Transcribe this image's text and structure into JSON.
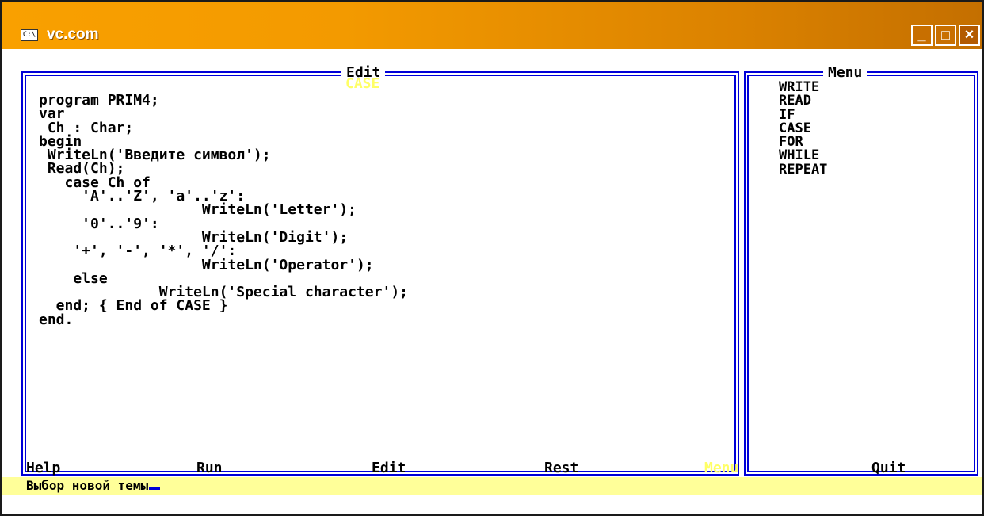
{
  "window": {
    "title": "vc.com",
    "icon": "console-icon",
    "icon_label": "C:\\",
    "buttons": {
      "minimize": "_",
      "maximize": "□",
      "close": "×"
    }
  },
  "edit_panel": {
    "title": "Edit",
    "subtitle": "CASE",
    "code_lines": [
      "program PRIM4;",
      "var",
      " Ch : Char;",
      "begin",
      " WriteLn('Введите символ');",
      " Read(Ch);",
      "   case Ch of",
      "     'A'..'Z', 'a'..'z':",
      "                   WriteLn('Letter');",
      "     '0'..'9':",
      "                   WriteLn('Digit');",
      "    '+', '-', '*', '/':",
      "                   WriteLn('Operator');",
      "    else",
      "              WriteLn('Special character');",
      "  end; { End of CASE }",
      "end."
    ]
  },
  "menu_panel": {
    "title": "Menu",
    "items": [
      "WRITE",
      "READ",
      "IF",
      "CASE",
      "FOR",
      "WHILE",
      "REPEAT"
    ]
  },
  "bottom_bar": {
    "help": "Help",
    "run": "Run",
    "edit": "Edit",
    "rest": "Rest",
    "menu": "Menu",
    "quit": "Quit"
  },
  "status": {
    "text": "Выбор новой темы"
  },
  "colors": {
    "title_gradient_start": "#f9a000",
    "title_gradient_end": "#c46f00",
    "frame_blue": "#0000d8",
    "highlight_yellow": "#ffff66",
    "status_bg": "#ffff99"
  }
}
